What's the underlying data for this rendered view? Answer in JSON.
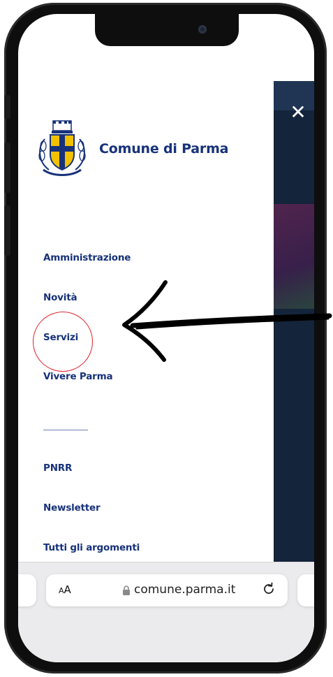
{
  "brand": {
    "title": "Comune di Parma",
    "logo_icon": "coat-of-arms-icon"
  },
  "menu": {
    "primary": [
      {
        "label": "Amministrazione"
      },
      {
        "label": "Novità"
      },
      {
        "label": "Servizi",
        "highlighted": true
      },
      {
        "label": "Vivere Parma"
      }
    ],
    "secondary": [
      {
        "label": "PNRR"
      },
      {
        "label": "Newsletter"
      },
      {
        "label": "Tutti gli argomenti"
      }
    ]
  },
  "browser": {
    "text_size_button": "AA",
    "url": "comune.parma.it",
    "lock_icon": "lock-icon",
    "reload_icon": "reload-icon"
  },
  "annotation": {
    "circle_color": "#e0202a",
    "arrow_color": "#000000"
  },
  "colors": {
    "brand_blue": "#17327a",
    "overlay": "#14243a"
  }
}
